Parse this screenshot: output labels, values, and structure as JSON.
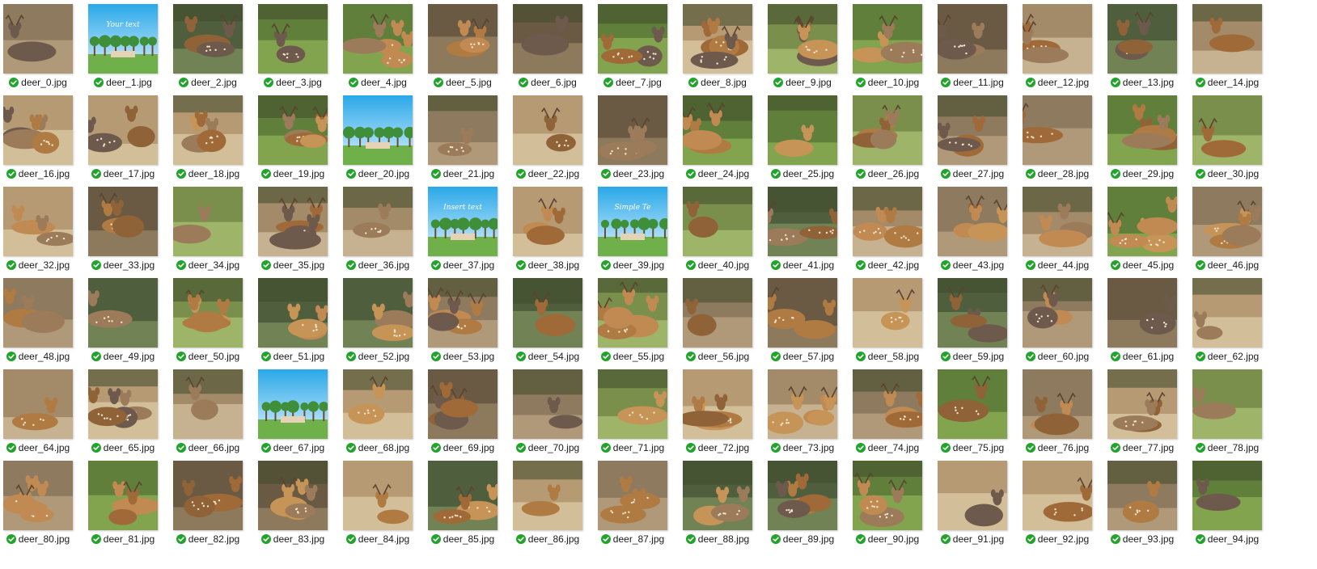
{
  "colors": {
    "sync_check": "#22a32c",
    "background": "#ffffff"
  },
  "status_icon": "synced-check-icon",
  "files": [
    {
      "name": "deer_0.jpg",
      "kind": "deer"
    },
    {
      "name": "deer_1.jpg",
      "kind": "design",
      "script_text": "Your text"
    },
    {
      "name": "deer_2.jpg",
      "kind": "deer"
    },
    {
      "name": "deer_3.jpg",
      "kind": "deer"
    },
    {
      "name": "deer_4.jpg",
      "kind": "deer"
    },
    {
      "name": "deer_5.jpg",
      "kind": "deer"
    },
    {
      "name": "deer_6.jpg",
      "kind": "deer"
    },
    {
      "name": "deer_7.jpg",
      "kind": "deer"
    },
    {
      "name": "deer_8.jpg",
      "kind": "deer"
    },
    {
      "name": "deer_9.jpg",
      "kind": "deer"
    },
    {
      "name": "deer_10.jpg",
      "kind": "deer"
    },
    {
      "name": "deer_11.jpg",
      "kind": "deer"
    },
    {
      "name": "deer_12.jpg",
      "kind": "deer"
    },
    {
      "name": "deer_13.jpg",
      "kind": "deer"
    },
    {
      "name": "deer_14.jpg",
      "kind": "deer"
    },
    {
      "name": "deer_16.jpg",
      "kind": "deer"
    },
    {
      "name": "deer_17.jpg",
      "kind": "deer"
    },
    {
      "name": "deer_18.jpg",
      "kind": "deer"
    },
    {
      "name": "deer_19.jpg",
      "kind": "deer"
    },
    {
      "name": "deer_20.jpg",
      "kind": "design",
      "script_text": ""
    },
    {
      "name": "deer_21.jpg",
      "kind": "deer"
    },
    {
      "name": "deer_22.jpg",
      "kind": "deer"
    },
    {
      "name": "deer_23.jpg",
      "kind": "deer"
    },
    {
      "name": "deer_24.jpg",
      "kind": "deer"
    },
    {
      "name": "deer_25.jpg",
      "kind": "deer"
    },
    {
      "name": "deer_26.jpg",
      "kind": "deer"
    },
    {
      "name": "deer_27.jpg",
      "kind": "deer"
    },
    {
      "name": "deer_28.jpg",
      "kind": "deer"
    },
    {
      "name": "deer_29.jpg",
      "kind": "deer"
    },
    {
      "name": "deer_30.jpg",
      "kind": "deer"
    },
    {
      "name": "deer_32.jpg",
      "kind": "deer"
    },
    {
      "name": "deer_33.jpg",
      "kind": "deer"
    },
    {
      "name": "deer_34.jpg",
      "kind": "deer"
    },
    {
      "name": "deer_35.jpg",
      "kind": "deer"
    },
    {
      "name": "deer_36.jpg",
      "kind": "deer"
    },
    {
      "name": "deer_37.jpg",
      "kind": "design",
      "script_text": "Insert text"
    },
    {
      "name": "deer_38.jpg",
      "kind": "deer"
    },
    {
      "name": "deer_39.jpg",
      "kind": "design",
      "script_text": "Simple Te"
    },
    {
      "name": "deer_40.jpg",
      "kind": "deer"
    },
    {
      "name": "deer_41.jpg",
      "kind": "deer"
    },
    {
      "name": "deer_42.jpg",
      "kind": "deer"
    },
    {
      "name": "deer_43.jpg",
      "kind": "deer"
    },
    {
      "name": "deer_44.jpg",
      "kind": "deer"
    },
    {
      "name": "deer_45.jpg",
      "kind": "deer"
    },
    {
      "name": "deer_46.jpg",
      "kind": "deer"
    },
    {
      "name": "deer_48.jpg",
      "kind": "deer"
    },
    {
      "name": "deer_49.jpg",
      "kind": "deer"
    },
    {
      "name": "deer_50.jpg",
      "kind": "deer"
    },
    {
      "name": "deer_51.jpg",
      "kind": "deer"
    },
    {
      "name": "deer_52.jpg",
      "kind": "deer"
    },
    {
      "name": "deer_53.jpg",
      "kind": "deer"
    },
    {
      "name": "deer_54.jpg",
      "kind": "deer"
    },
    {
      "name": "deer_55.jpg",
      "kind": "deer"
    },
    {
      "name": "deer_56.jpg",
      "kind": "deer"
    },
    {
      "name": "deer_57.jpg",
      "kind": "deer"
    },
    {
      "name": "deer_58.jpg",
      "kind": "deer"
    },
    {
      "name": "deer_59.jpg",
      "kind": "deer"
    },
    {
      "name": "deer_60.jpg",
      "kind": "deer"
    },
    {
      "name": "deer_61.jpg",
      "kind": "deer"
    },
    {
      "name": "deer_62.jpg",
      "kind": "deer"
    },
    {
      "name": "deer_64.jpg",
      "kind": "deer"
    },
    {
      "name": "deer_65.jpg",
      "kind": "deer"
    },
    {
      "name": "deer_66.jpg",
      "kind": "deer"
    },
    {
      "name": "deer_67.jpg",
      "kind": "design",
      "script_text": ""
    },
    {
      "name": "deer_68.jpg",
      "kind": "deer"
    },
    {
      "name": "deer_69.jpg",
      "kind": "deer"
    },
    {
      "name": "deer_70.jpg",
      "kind": "deer"
    },
    {
      "name": "deer_71.jpg",
      "kind": "deer"
    },
    {
      "name": "deer_72.jpg",
      "kind": "deer"
    },
    {
      "name": "deer_73.jpg",
      "kind": "deer"
    },
    {
      "name": "deer_74.jpg",
      "kind": "deer"
    },
    {
      "name": "deer_75.jpg",
      "kind": "deer"
    },
    {
      "name": "deer_76.jpg",
      "kind": "deer"
    },
    {
      "name": "deer_77.jpg",
      "kind": "deer"
    },
    {
      "name": "deer_78.jpg",
      "kind": "deer"
    },
    {
      "name": "deer_80.jpg",
      "kind": "deer"
    },
    {
      "name": "deer_81.jpg",
      "kind": "deer"
    },
    {
      "name": "deer_82.jpg",
      "kind": "deer"
    },
    {
      "name": "deer_83.jpg",
      "kind": "deer"
    },
    {
      "name": "deer_84.jpg",
      "kind": "deer"
    },
    {
      "name": "deer_85.jpg",
      "kind": "deer"
    },
    {
      "name": "deer_86.jpg",
      "kind": "deer"
    },
    {
      "name": "deer_87.jpg",
      "kind": "deer"
    },
    {
      "name": "deer_88.jpg",
      "kind": "deer"
    },
    {
      "name": "deer_89.jpg",
      "kind": "deer"
    },
    {
      "name": "deer_90.jpg",
      "kind": "deer"
    },
    {
      "name": "deer_91.jpg",
      "kind": "deer"
    },
    {
      "name": "deer_92.jpg",
      "kind": "deer"
    },
    {
      "name": "deer_93.jpg",
      "kind": "deer"
    },
    {
      "name": "deer_94.jpg",
      "kind": "deer"
    }
  ]
}
